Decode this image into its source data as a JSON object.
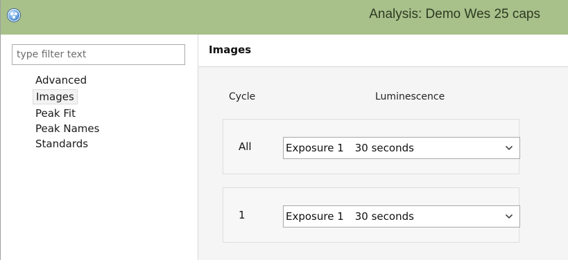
{
  "window": {
    "title": "Analysis: Demo Wes 25 caps",
    "icon": "app-globe-icon",
    "titlebar_color": "#a8c08a"
  },
  "nav": {
    "filter_placeholder": "type filter text",
    "items": [
      {
        "label": "Advanced",
        "selected": false
      },
      {
        "label": "Images",
        "selected": true
      },
      {
        "label": "Peak Fit",
        "selected": false
      },
      {
        "label": "Peak Names",
        "selected": false
      },
      {
        "label": "Standards",
        "selected": false
      }
    ]
  },
  "content": {
    "title": "Images",
    "columns": {
      "cycle": "Cycle",
      "luminescence": "Luminescence"
    },
    "rows": [
      {
        "cycle": "All",
        "exposure": "Exposure 1",
        "duration": "30 seconds",
        "icon": "chevron-down-icon"
      },
      {
        "cycle": "1",
        "exposure": "Exposure 1",
        "duration": "30 seconds",
        "icon": "chevron-down-icon"
      }
    ]
  }
}
